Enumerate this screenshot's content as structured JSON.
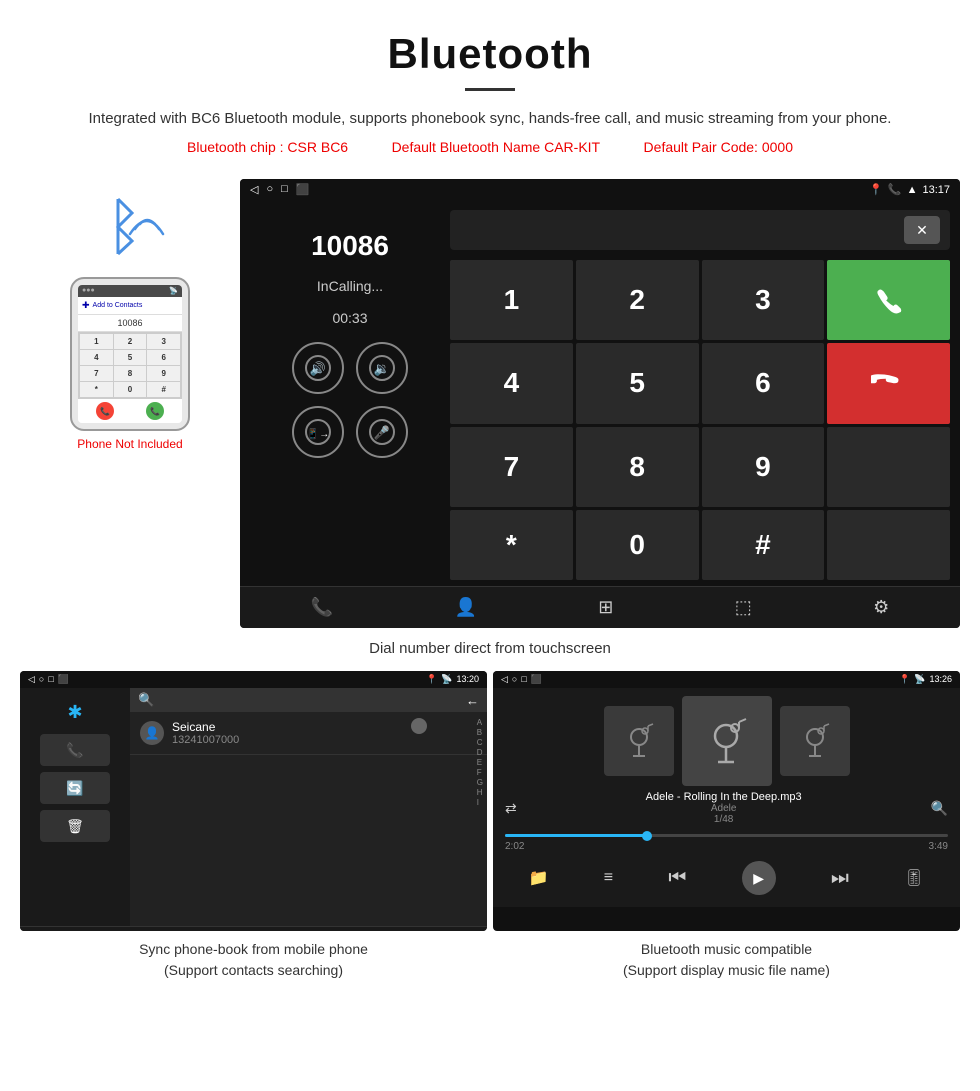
{
  "header": {
    "title": "Bluetooth",
    "description": "Integrated with BC6 Bluetooth module, supports phonebook sync, hands-free call, and music streaming from your phone.",
    "spec_chip": "Bluetooth chip : CSR BC6",
    "spec_name": "Default Bluetooth Name CAR-KIT",
    "spec_code": "Default Pair Code: 0000"
  },
  "main_screen": {
    "statusbar": {
      "nav_icons": [
        "◁",
        "○",
        "□",
        "⬛"
      ],
      "right_icons": [
        "📍",
        "📞",
        "▲",
        "13:17"
      ]
    },
    "dialer": {
      "number": "10086",
      "status": "InCalling...",
      "timer": "00:33"
    },
    "numpad": {
      "keys": [
        "1",
        "2",
        "3",
        "4",
        "5",
        "6",
        "7",
        "8",
        "9",
        "*",
        "0",
        "#"
      ]
    },
    "bottombar_icons": [
      "📞",
      "👤",
      "⊞",
      "⬚",
      "⚙"
    ]
  },
  "caption_main": "Dial number direct from touchscreen",
  "bottom_left": {
    "statusbar_time": "13:20",
    "contact_name": "Seicane",
    "contact_number": "13241007000",
    "alphabet": [
      "A",
      "B",
      "C",
      "D",
      "E",
      "F",
      "G",
      "H",
      "I"
    ],
    "caption": "Sync phone-book from mobile phone\n(Support contacts searching)"
  },
  "bottom_right": {
    "statusbar_time": "13:26",
    "track_name": "Adele - Rolling In the Deep.mp3",
    "artist": "Adele",
    "track_count": "1/48",
    "time_current": "2:02",
    "time_total": "3:49",
    "caption": "Bluetooth music compatible\n(Support display music file name)"
  },
  "phone_mockup": {
    "not_included": "Phone Not Included",
    "numpad": [
      "1",
      "2",
      "3",
      "4",
      "5",
      "6",
      "7",
      "8",
      "9",
      "*",
      "0",
      "#"
    ]
  }
}
